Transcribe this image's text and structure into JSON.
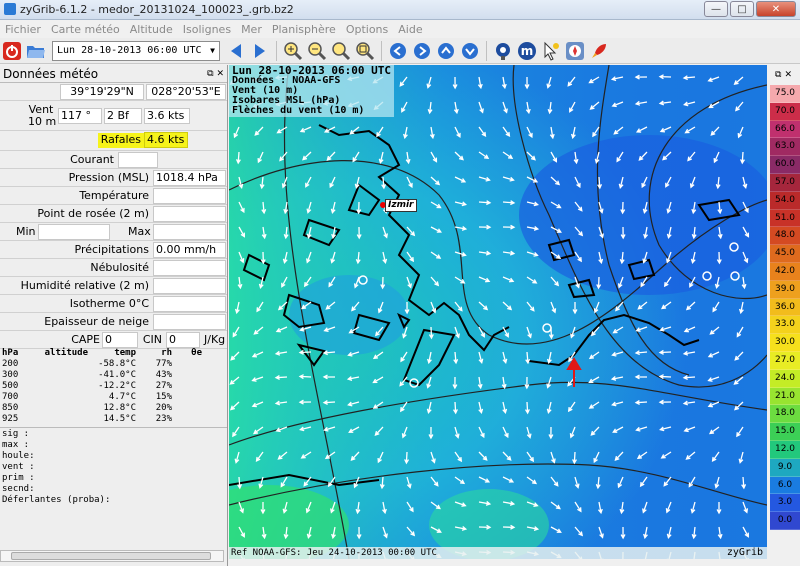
{
  "window": {
    "title": "zyGrib-6.1.2 - medor_20131024_100023_.grb.bz2"
  },
  "menu": [
    "Fichier",
    "Carte météo",
    "Altitude",
    "Isolignes",
    "Mer",
    "Planisphère",
    "Options",
    "Aide"
  ],
  "toolbar": {
    "date_value": "Lun 28-10-2013 06:00 UTC"
  },
  "panel": {
    "title": "Données météo",
    "lat": "39°19'29\"N",
    "lon": "028°20'53\"E",
    "wind_label": "Vent\n10 m",
    "wind_dir": "117 °",
    "wind_bf": "2 Bf",
    "wind_speed": "3.6  kts",
    "gust_label": "Rafales",
    "gust_value": "4.6  kts",
    "current_label": "Courant",
    "pressure_label": "Pression (MSL)",
    "pressure_value": "1018.4 hPa",
    "temp_label": "Température",
    "dew_label": "Point de rosée (2 m)",
    "min_label": "Min",
    "max_label": "Max",
    "precip_label": "Précipitations",
    "precip_value": "0.00 mm/h",
    "cloud_label": "Nébulosité",
    "humidity_label": "Humidité relative (2 m)",
    "isotherm_label": "Isotherme 0°C",
    "snow_label": "Epaisseur de neige",
    "cape_label": "CAPE",
    "cape_value": "0",
    "cin_label": "CIN",
    "cin_value": "0",
    "cin_unit": "J/Kg",
    "profile_header": [
      "hPa",
      "altitude",
      "temp",
      "rh",
      "θe"
    ],
    "profile_rows": [
      [
        "200",
        "",
        "-58.8°C",
        "77%",
        ""
      ],
      [
        "300",
        "",
        "-41.0°C",
        "43%",
        ""
      ],
      [
        "500",
        "",
        "-12.2°C",
        "27%",
        ""
      ],
      [
        "700",
        "",
        "4.7°C",
        "15%",
        ""
      ],
      [
        "850",
        "",
        "12.8°C",
        "20%",
        ""
      ],
      [
        "925",
        "",
        "14.5°C",
        "23%",
        ""
      ]
    ],
    "wave_lines": [
      "sig  :",
      "max  :",
      "houle:",
      "vent :",
      "prim :",
      "secnd:",
      "Déferlantes (proba):"
    ]
  },
  "map": {
    "info_lines": [
      "Lun 28-10-2013 06:00 UTC",
      "Données : NOAA-GFS",
      "Vent (10 m)",
      "Isobares MSL (hPa)",
      "Flèches du vent (10 m)"
    ],
    "city": "Izmir",
    "ref": "Ref NOAA-GFS: Jeu 24-10-2013 00:00 UTC",
    "brand": "zyGrib"
  },
  "scale": {
    "values": [
      "75.0",
      "70.0",
      "66.0",
      "63.0",
      "60.0",
      "57.0",
      "54.0",
      "51.0",
      "48.0",
      "45.0",
      "42.0",
      "39.0",
      "36.0",
      "33.0",
      "30.0",
      "27.0",
      "24.0",
      "21.0",
      "18.0",
      "15.0",
      "12.0",
      "9.0",
      "6.0",
      "3.0",
      "0.0"
    ],
    "colors": [
      "#f5a9ad",
      "#cc2d49",
      "#c0306e",
      "#a02a62",
      "#8a2a66",
      "#a5263c",
      "#ba2a2a",
      "#c83228",
      "#d44a22",
      "#de6a1e",
      "#e8821c",
      "#eea01e",
      "#f2bc1c",
      "#f4d21c",
      "#f6e01c",
      "#e8ec24",
      "#c4ec26",
      "#98e430",
      "#6cdc40",
      "#3ccf56",
      "#22c87c",
      "#1ea8c0",
      "#1a7ce0",
      "#2458e0",
      "#3048d0"
    ]
  }
}
